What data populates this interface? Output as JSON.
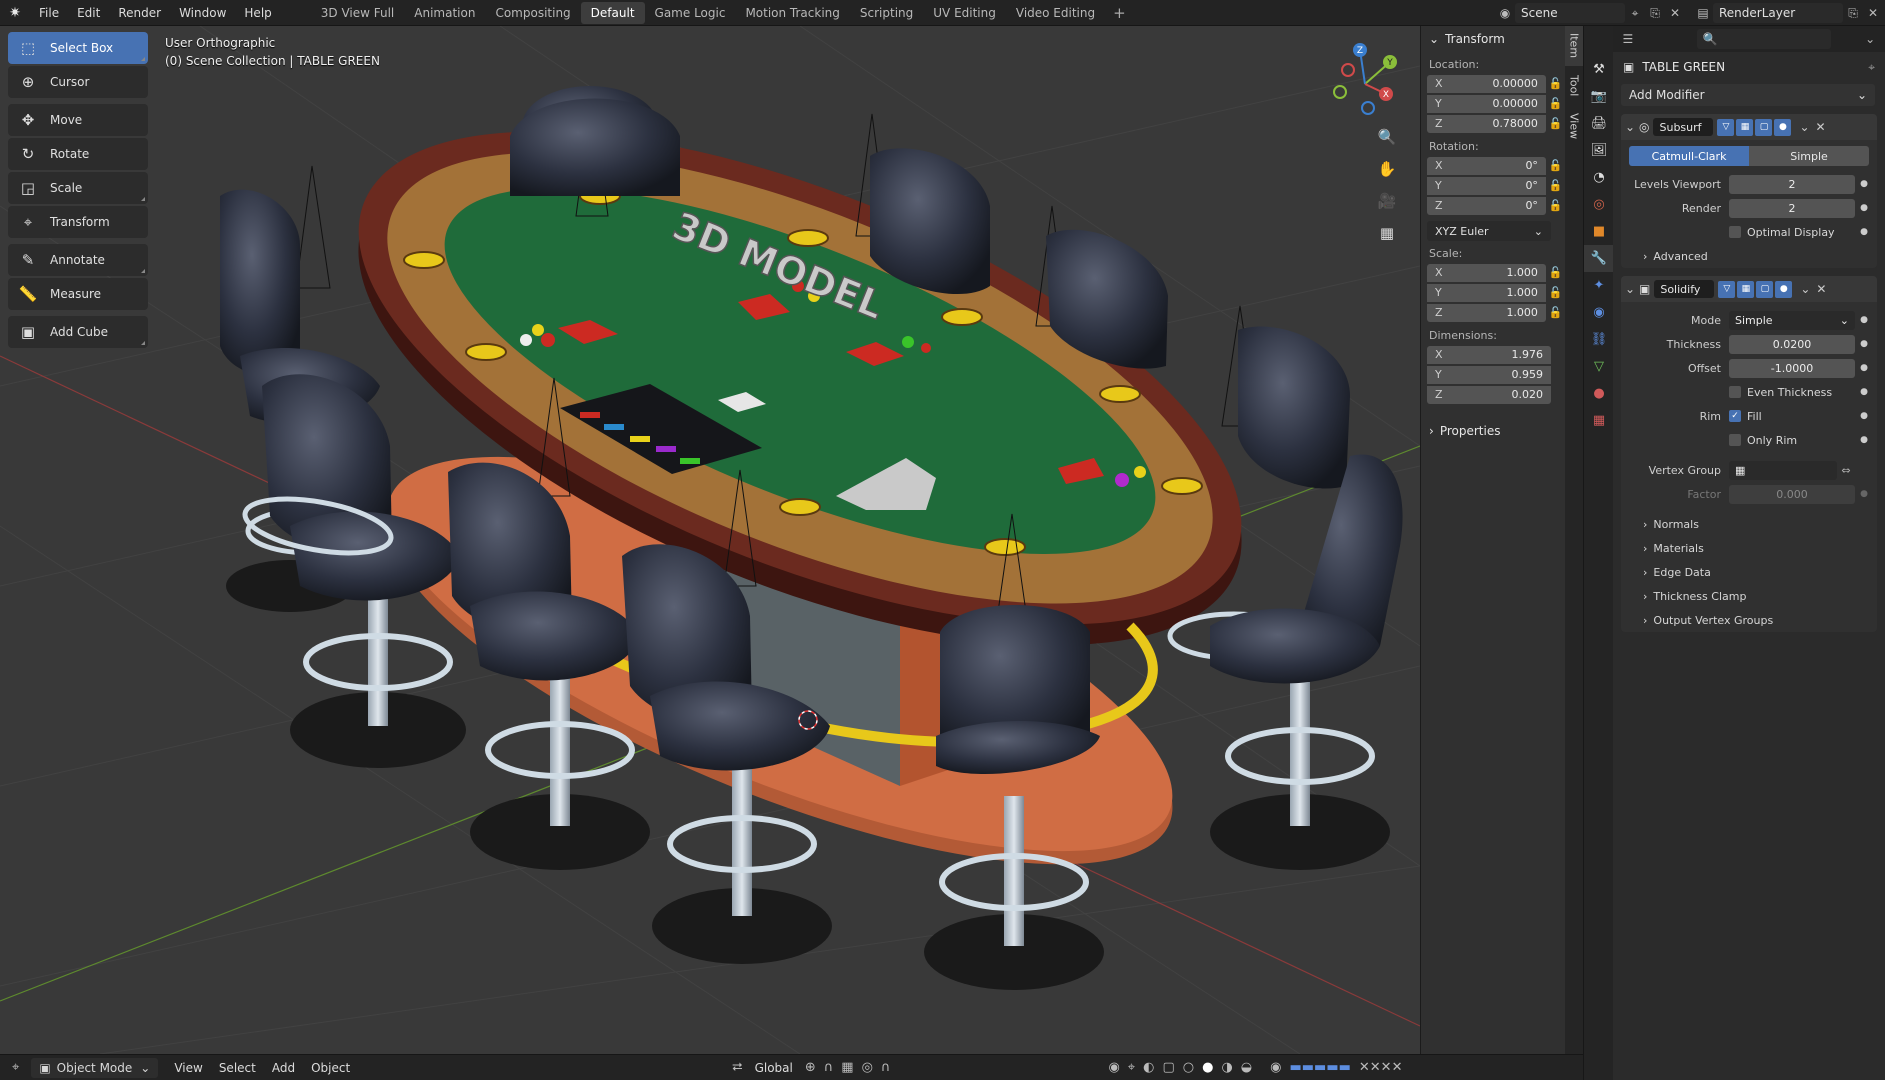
{
  "topbar": {
    "menus": [
      "File",
      "Edit",
      "Render",
      "Window",
      "Help"
    ],
    "workspace_tabs": [
      "3D View Full",
      "Animation",
      "Compositing",
      "Default",
      "Game Logic",
      "Motion Tracking",
      "Scripting",
      "UV Editing",
      "Video Editing"
    ],
    "active_tab": "Default",
    "scene": "Scene",
    "render_layer": "RenderLayer"
  },
  "viewport": {
    "view_name": "User Orthographic",
    "collection": "(0) Scene Collection | TABLE GREEN",
    "table_text": "3D MODEL"
  },
  "tools": [
    "Select Box",
    "Cursor",
    "Move",
    "Rotate",
    "Scale",
    "Transform",
    "Annotate",
    "Measure",
    "Add Cube"
  ],
  "tool_icons": [
    "select-box-icon",
    "cursor-icon",
    "move-icon",
    "rotate-icon",
    "scale-icon",
    "transform-icon",
    "annotate-icon",
    "measure-icon",
    "add-cube-icon"
  ],
  "gizmo": {
    "x": "X",
    "y": "Y",
    "z": "Z"
  },
  "npanel": {
    "header": "Transform",
    "location_label": "Location:",
    "location": {
      "x": "0.00000",
      "y": "0.00000",
      "z": "0.78000"
    },
    "rotation_label": "Rotation:",
    "rotation": {
      "x": "0°",
      "y": "0°",
      "z": "0°"
    },
    "rotation_mode": "XYZ Euler",
    "scale_label": "Scale:",
    "scale": {
      "x": "1.000",
      "y": "1.000",
      "z": "1.000"
    },
    "dimensions_label": "Dimensions:",
    "dimensions": {
      "x": "1.976",
      "y": "0.959",
      "z": "0.020"
    },
    "properties": "Properties",
    "axes": [
      "X",
      "Y",
      "Z"
    ],
    "tabs": [
      "Item",
      "Tool",
      "View"
    ]
  },
  "properties": {
    "object_name": "TABLE GREEN",
    "add_modifier": "Add Modifier",
    "subsurf": {
      "name": "Subsurf",
      "catmull": "Catmull-Clark",
      "simple": "Simple",
      "levels_viewport_label": "Levels Viewport",
      "levels_viewport": "2",
      "render_label": "Render",
      "render": "2",
      "optimal_display": "Optimal Display",
      "advanced": "Advanced"
    },
    "solidify": {
      "name": "Solidify",
      "mode_label": "Mode",
      "mode": "Simple",
      "thickness_label": "Thickness",
      "thickness": "0.0200",
      "offset_label": "Offset",
      "offset": "-1.0000",
      "even_thickness": "Even Thickness",
      "rim_label": "Rim",
      "fill": "Fill",
      "only_rim": "Only Rim",
      "vertex_group_label": "Vertex Group",
      "factor_label": "Factor",
      "factor": "0.000",
      "sections": [
        "Normals",
        "Materials",
        "Edge Data",
        "Thickness Clamp",
        "Output Vertex Groups"
      ]
    }
  },
  "bottombar": {
    "mode": "Object Mode",
    "menus": [
      "View",
      "Select",
      "Add",
      "Object"
    ],
    "orientation": "Global"
  },
  "colors": {
    "accent": "#4772b3",
    "felt": "#1f6b3a",
    "rail": "#6b2a1f",
    "wood": "#a0703a",
    "gold": "#e8c81a",
    "base": "#c8603a",
    "chair": "#2f3442"
  }
}
